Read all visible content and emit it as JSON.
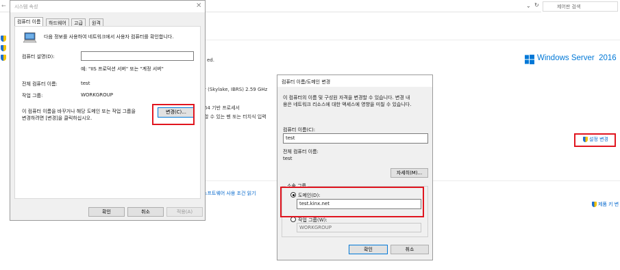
{
  "background": {
    "search_placeholder": "제어판 검색",
    "text_fragment_ed": "ed.",
    "processor_text": "r (Skylake, IBRS)  2.59 GHz",
    "system_type_text": "64 기반 프로세서",
    "pen_touch_text": "할 수 있는 펜 또는 터치식 입력",
    "license_link": "소프트웨어 사용 조건 읽기",
    "change_settings_link": "설정 변경",
    "product_key_link": "제품 키 변",
    "windows_server_logo": "Windows Server  2016"
  },
  "sysprop": {
    "title": "시스템 속성",
    "tabs": [
      "컴퓨터 이름",
      "하드웨어",
      "고급",
      "원격"
    ],
    "intro": "다음 정보를 사용하여 네트워크에서 사용자 컴퓨터를 확인합니다.",
    "description_label": "컴퓨터 설명(D):",
    "description_value": "",
    "description_hint": "예: \"IIS 프로덕션 서버\" 또는 \"계정 서버\"",
    "fullname_label": "전체 컴퓨터 이름:",
    "fullname_value": "test",
    "workgroup_label": "작업 그룹:",
    "workgroup_value": "WORKGROUP",
    "rename_text_1": "이 컴퓨터 이름을 바꾸거나 해당 도메인 또는 작업 그룹을",
    "rename_text_2": "변경하려면 [변경]을 클릭하십시오.",
    "change_button": "변경(C)...",
    "ok_button": "확인",
    "cancel_button": "취소",
    "apply_button": "적용(A)"
  },
  "rename_dialog": {
    "title": "컴퓨터 이름/도메인 변경",
    "desc_1": "이 컴퓨터의 이름 및 구성원 자격을 변경할 수 있습니다. 변경 내",
    "desc_2": "용은 네트워크 리소스에 대한 액세스에 영향을 미칠 수 있습니다.",
    "name_label": "컴퓨터 이름(C):",
    "name_value": "test",
    "fullname_label": "전체 컴퓨터 이름:",
    "fullname_value": "test",
    "more_button": "자세히(M)...",
    "member_of_label": "소속 그룹",
    "domain_label": "도메인(D):",
    "domain_value": "test.kinx.net",
    "workgroup_label": "작업 그룹(W):",
    "workgroup_value": "WORKGROUP",
    "ok_button": "확인",
    "cancel_button": "취소"
  },
  "colors": {
    "highlight": "#e0141e",
    "link": "#0066cc",
    "windows_blue": "#0078d7"
  }
}
